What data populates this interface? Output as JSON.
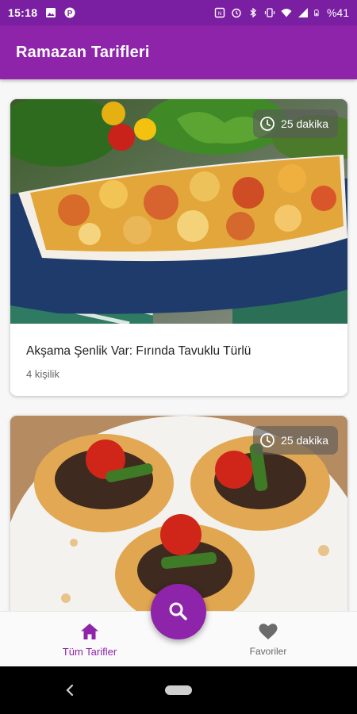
{
  "status_bar": {
    "time": "15:18",
    "battery": "%41",
    "left_icons": [
      "image-icon",
      "parking-icon"
    ],
    "right_icons": [
      "nfc-icon",
      "alarm-icon",
      "bluetooth-icon",
      "vibrate-icon",
      "wifi-icon",
      "signal-icon",
      "battery-icon"
    ]
  },
  "app_bar": {
    "title": "Ramazan Tarifleri"
  },
  "recipes": [
    {
      "title": "Akşama Şenlik Var: Fırında Tavuklu Türlü",
      "servings": "4 kişilik",
      "duration": "25 dakika",
      "image": "baked-chicken-vegetables-dish"
    },
    {
      "title": "",
      "servings": "",
      "duration": "25 dakika",
      "image": "stuffed-pastry-boats-with-meat-tomato-pepper"
    }
  ],
  "bottom_nav": {
    "items": [
      {
        "label": "Tüm Tarifler",
        "icon": "home-icon",
        "active": true
      },
      {
        "label": "Favoriler",
        "icon": "heart-icon",
        "active": false
      }
    ],
    "fab_icon": "search-icon"
  },
  "colors": {
    "primary": "#8e24aa",
    "status_bar": "#7b1fa2",
    "inactive": "#666666"
  }
}
